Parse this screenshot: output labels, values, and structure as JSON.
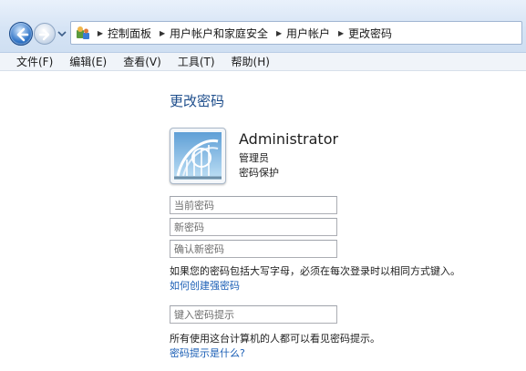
{
  "breadcrumb": {
    "home_icon": "control-panel-icon",
    "items": [
      {
        "label": "控制面板"
      },
      {
        "label": "用户帐户和家庭安全"
      },
      {
        "label": "用户帐户"
      },
      {
        "label": "更改密码"
      }
    ]
  },
  "menubar": {
    "items": [
      {
        "label": "文件(F)"
      },
      {
        "label": "编辑(E)"
      },
      {
        "label": "查看(V)"
      },
      {
        "label": "工具(T)"
      },
      {
        "label": "帮助(H)"
      }
    ]
  },
  "page": {
    "title": "更改密码",
    "user": {
      "name": "Administrator",
      "role": "管理员",
      "status": "密码保护",
      "picture_icon": "user-picture-icon"
    },
    "fields": {
      "current_password_placeholder": "当前密码",
      "new_password_placeholder": "新密码",
      "confirm_password_placeholder": "确认新密码",
      "hint_placeholder": "键入密码提示"
    },
    "caps_note": "如果您的密码包括大写字母，必须在每次登录时以相同方式键入。",
    "strong_password_link": "如何创建强密码",
    "hint_note": "所有使用这台计算机的人都可以看见密码提示。",
    "hint_link": "密码提示是什么?"
  },
  "colors": {
    "title": "#1e4e8c",
    "link": "#1a5eb5",
    "addrbar": "#d6e4f5"
  }
}
